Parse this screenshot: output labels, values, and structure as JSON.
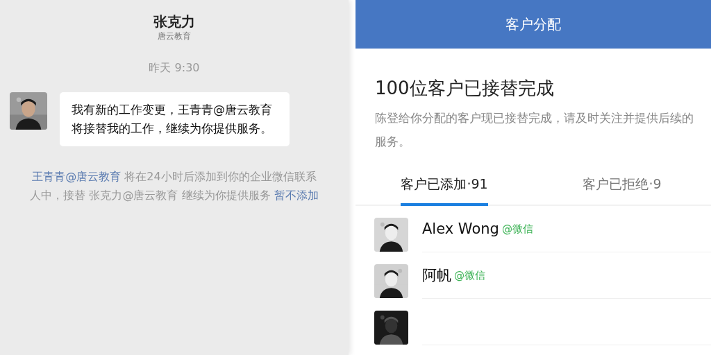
{
  "chat": {
    "title": "张克力",
    "subtitle": "唐云教育",
    "timestamp": "昨天 9:30",
    "message": {
      "avatar": {
        "kind": "picture"
      },
      "text": "我有新的工作变更，王青青@唐云教育将接替我的工作，继续为你提供服务。"
    },
    "notice": [
      {
        "kind": "link",
        "text": "王青青@唐云教育"
      },
      {
        "kind": "plain",
        "text": " 将在24小时后添加到你的企业微信联系人中，接替 张克力@唐云教育 继续为你提供服务 "
      },
      {
        "kind": "link",
        "text": "暂不添加"
      }
    ]
  },
  "assignment": {
    "header": "客户分配",
    "title": "100位客户已接替完成",
    "description": "陈登给你分配的客户现已接替完成，请及时关注并提供后续的服务。",
    "tabs": [
      {
        "label": "客户已添加·91",
        "selected": true
      },
      {
        "label": "客户已拒绝·9",
        "selected": false
      }
    ],
    "customers": [
      {
        "name": "Alex Wong",
        "source": "@微信",
        "avatar": {
          "kind": "picture"
        }
      },
      {
        "name": "阿帆",
        "source": "@微信",
        "avatar": {
          "kind": "picture"
        }
      },
      {
        "avatar": {
          "kind": "picture"
        }
      }
    ]
  }
}
